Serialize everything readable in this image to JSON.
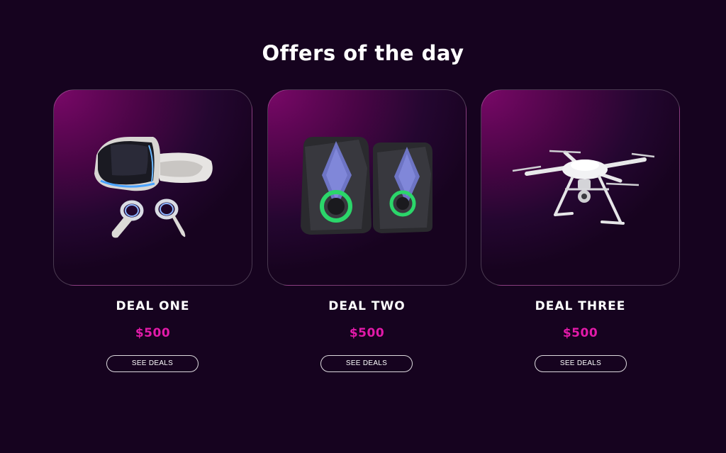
{
  "section": {
    "title": "Offers of the day"
  },
  "deals": [
    {
      "name": "DEAL ONE",
      "price": "$500",
      "button_label": "SEE DEALS",
      "product_icon": "vr-headset-icon"
    },
    {
      "name": "DEAL TWO",
      "price": "$500",
      "button_label": "SEE DEALS",
      "product_icon": "speakers-icon"
    },
    {
      "name": "DEAL THREE",
      "price": "$500",
      "button_label": "SEE DEALS",
      "product_icon": "drone-icon"
    }
  ],
  "colors": {
    "background": "#16031f",
    "accent_price": "#e21aa9",
    "card_glow": "#7a0868",
    "text": "#ffffff"
  }
}
